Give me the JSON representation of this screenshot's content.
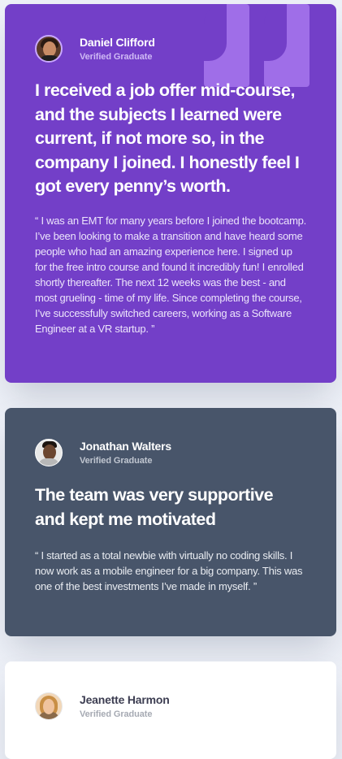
{
  "testimonials": [
    {
      "name": "Daniel Clifford",
      "role": "Verified Graduate",
      "headline": "I received a job offer mid-course, and the subjects I learned were current, if not more so, in the company I joined. I honestly feel I got every penny’s worth.",
      "quote": "“ I was an EMT for many years before I joined the bootcamp. I’ve been looking to make a transition and have heard some people who had an amazing experience here. I signed up for the free intro course and found it incredibly fun! I enrolled shortly thereafter. The next 12 weeks was the best - and most grueling - time of my life. Since completing the course, I’ve successfully switched careers, working as a Software Engineer at a VR startup. ”",
      "background": "#733fc8",
      "icon": "quotation-mark-icon"
    },
    {
      "name": "Jonathan Walters",
      "role": "Verified Graduate",
      "headline": "The team was very supportive and kept me motivated",
      "quote": "“ I started as a total newbie with virtually no coding skills. I now work as a mobile engineer for a big company. This was one of the best investments I’ve made in myself. ”",
      "background": "#48556a"
    },
    {
      "name": "Jeanette Harmon",
      "role": "Verified Graduate",
      "background": "#ffffff"
    }
  ],
  "colors": {
    "page_background": "#eef1f8",
    "quote_mark": "#9f6ee8"
  }
}
